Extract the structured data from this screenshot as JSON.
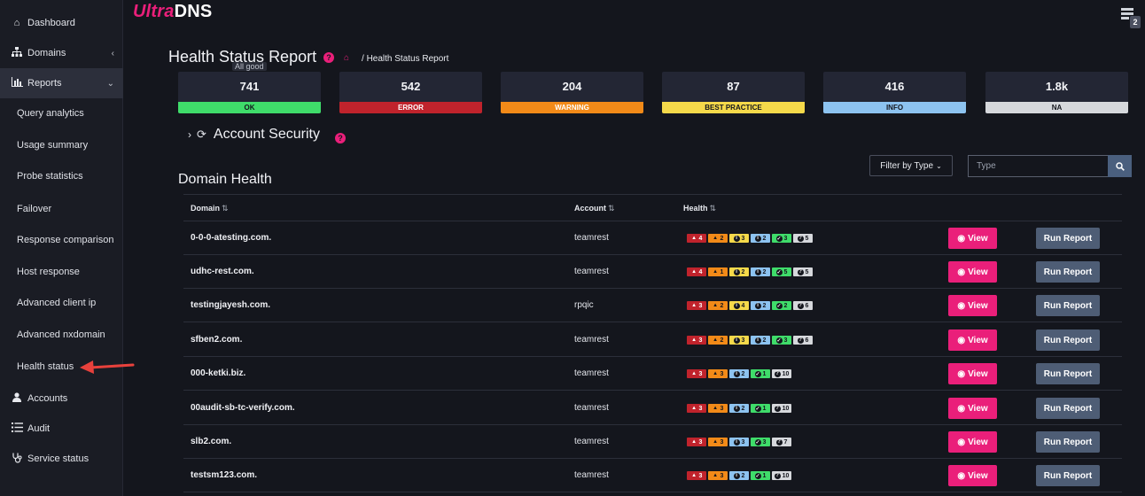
{
  "app": {
    "logo_part1": "Ultra",
    "logo_part2": "DNS",
    "menu_badge": "2"
  },
  "sidebar": {
    "items": [
      {
        "label": "Dashboard",
        "icon": "home-icon"
      },
      {
        "label": "Domains",
        "icon": "sitemap-icon"
      },
      {
        "label": "Reports",
        "icon": "bar-chart-icon"
      },
      {
        "label": "Accounts",
        "icon": "user-icon"
      },
      {
        "label": "Audit",
        "icon": "list-icon"
      },
      {
        "label": "Service status",
        "icon": "stethoscope-icon"
      }
    ],
    "reports_sub": [
      "Query analytics",
      "Usage summary",
      "Probe statistics",
      "Failover",
      "Response comparison",
      "Host response",
      "Advanced client ip",
      "Advanced nxdomain",
      "Health status"
    ]
  },
  "header": {
    "title": "Health Status Report",
    "breadcrumb_separator": "/",
    "breadcrumb": "Health Status Report",
    "tooltip": "All good"
  },
  "summary": [
    {
      "count": "741",
      "label": "OK",
      "color": "#3fdc6a",
      "text_color": "#14161d"
    },
    {
      "count": "542",
      "label": "ERROR",
      "color": "#c0232c",
      "text_color": "#ffffff"
    },
    {
      "count": "204",
      "label": "WARNING",
      "color": "#f28a18",
      "text_color": "#ffffff"
    },
    {
      "count": "87",
      "label": "BEST PRACTICE",
      "color": "#f5d94a",
      "text_color": "#14161d"
    },
    {
      "count": "416",
      "label": "INFO",
      "color": "#8dc3f0",
      "text_color": "#14161d"
    },
    {
      "count": "1.8k",
      "label": "NA",
      "color": "#d6d8dc",
      "text_color": "#14161d"
    }
  ],
  "account_security": {
    "title": "Account Security"
  },
  "domain_health": {
    "title": "Domain Health",
    "filter_label": "Filter by Type",
    "search_placeholder": "Type",
    "columns": {
      "domain": "Domain",
      "account": "Account",
      "health": "Health"
    },
    "view_label": "View",
    "run_label": "Run Report",
    "rows": [
      {
        "domain": "0-0-0-atesting.com.",
        "account": "teamrest",
        "health": [
          {
            "t": "err",
            "v": "4"
          },
          {
            "t": "warn",
            "v": "2"
          },
          {
            "t": "bp",
            "v": "3"
          },
          {
            "t": "info",
            "v": "2"
          },
          {
            "t": "ok",
            "v": "3"
          },
          {
            "t": "na",
            "v": "5"
          }
        ]
      },
      {
        "domain": "udhc-rest.com.",
        "account": "teamrest",
        "health": [
          {
            "t": "err",
            "v": "4"
          },
          {
            "t": "warn",
            "v": "1"
          },
          {
            "t": "bp",
            "v": "2"
          },
          {
            "t": "info",
            "v": "2"
          },
          {
            "t": "ok",
            "v": "5"
          },
          {
            "t": "na",
            "v": "5"
          }
        ]
      },
      {
        "domain": "testingjayesh.com.",
        "account": "rpqic",
        "health": [
          {
            "t": "err",
            "v": "3"
          },
          {
            "t": "warn",
            "v": "2"
          },
          {
            "t": "bp",
            "v": "4"
          },
          {
            "t": "info",
            "v": "2"
          },
          {
            "t": "ok",
            "v": "2"
          },
          {
            "t": "na",
            "v": "6"
          }
        ]
      },
      {
        "domain": "sfben2.com.",
        "account": "teamrest",
        "health": [
          {
            "t": "err",
            "v": "3"
          },
          {
            "t": "warn",
            "v": "2"
          },
          {
            "t": "bp",
            "v": "3"
          },
          {
            "t": "info",
            "v": "2"
          },
          {
            "t": "ok",
            "v": "3"
          },
          {
            "t": "na",
            "v": "6"
          }
        ]
      },
      {
        "domain": "000-ketki.biz.",
        "account": "teamrest",
        "health": [
          {
            "t": "err",
            "v": "3"
          },
          {
            "t": "warn",
            "v": "3"
          },
          {
            "t": "info",
            "v": "2"
          },
          {
            "t": "ok",
            "v": "1"
          },
          {
            "t": "na",
            "v": "10"
          }
        ]
      },
      {
        "domain": "00audit-sb-tc-verify.com.",
        "account": "teamrest",
        "health": [
          {
            "t": "err",
            "v": "3"
          },
          {
            "t": "warn",
            "v": "3"
          },
          {
            "t": "info",
            "v": "2"
          },
          {
            "t": "ok",
            "v": "1"
          },
          {
            "t": "na",
            "v": "10"
          }
        ]
      },
      {
        "domain": "slb2.com.",
        "account": "teamrest",
        "health": [
          {
            "t": "err",
            "v": "3"
          },
          {
            "t": "warn",
            "v": "3"
          },
          {
            "t": "info",
            "v": "3"
          },
          {
            "t": "ok",
            "v": "3"
          },
          {
            "t": "na",
            "v": "7"
          }
        ]
      },
      {
        "domain": "testsm123.com.",
        "account": "teamrest",
        "health": [
          {
            "t": "err",
            "v": "3"
          },
          {
            "t": "warn",
            "v": "3"
          },
          {
            "t": "info",
            "v": "2"
          },
          {
            "t": "ok",
            "v": "1"
          },
          {
            "t": "na",
            "v": "10"
          }
        ]
      }
    ]
  }
}
